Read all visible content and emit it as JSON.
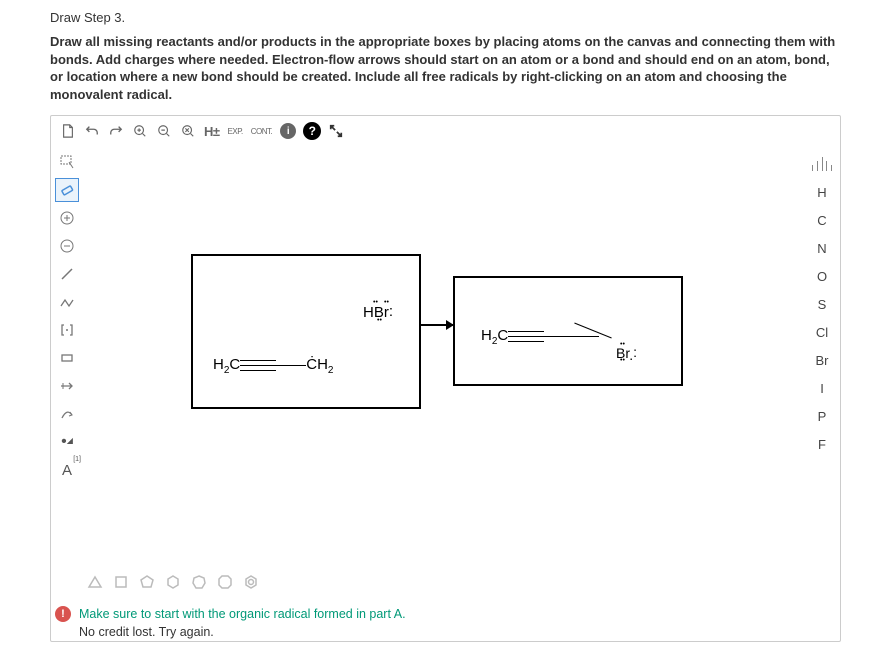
{
  "header": {
    "title": "Draw Step 3.",
    "instructions": "Draw all missing reactants and/or products in the appropriate boxes by placing atoms on the canvas and connecting them with bonds. Add charges where needed. Electron-flow arrows should start on an atom or a bond and should end on an atom, bond, or location where a new bond should be created. Include all free radicals by right-clicking on an atom and choosing the monovalent radical."
  },
  "top_toolbar": {
    "new": "new",
    "undo": "undo",
    "redo": "redo",
    "zoom_in": "zoom-in",
    "zoom_out": "zoom-out",
    "zoom_fit": "zoom-fit",
    "h_toggle": "H±",
    "exp": "EXP.",
    "cont": "CONT.",
    "info": "i",
    "help": "?",
    "fullscreen": "fullscreen"
  },
  "left_toolbar": {
    "marquee": "marquee",
    "eraser": "eraser",
    "plus": "plus",
    "minus": "minus",
    "single_bond": "single-bond",
    "double_bond": "double-bond",
    "bracket": "bracket",
    "rect": "rect",
    "chain": "chain",
    "curve_arrow": "curve-arrow",
    "radical": "radical",
    "footnote": "[1]",
    "atom_label": "A"
  },
  "right_toolbar": {
    "periodic": "periodic",
    "elements": [
      "H",
      "C",
      "N",
      "O",
      "S",
      "Cl",
      "Br",
      "I",
      "P",
      "F"
    ]
  },
  "bottom_toolbar": {
    "shapes": [
      "triangle",
      "square",
      "pentagon",
      "hexagon",
      "heptagon",
      "octagon",
      "benzene"
    ]
  },
  "reaction": {
    "reactant_left": "H₂C",
    "reactant_right": "ĊH₂",
    "reagent": "HBr",
    "product_left": "H₂C",
    "product_right": "Br"
  },
  "feedback": {
    "icon": "!",
    "line1": "Make sure to start with the organic radical formed in part A.",
    "line2": "No credit lost. Try again."
  }
}
